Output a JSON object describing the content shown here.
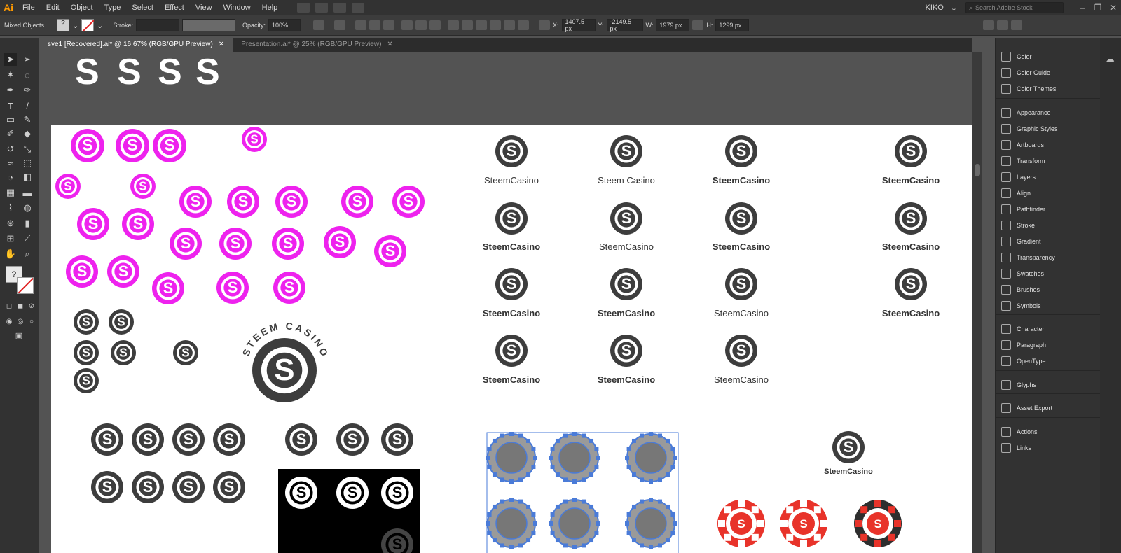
{
  "app": {
    "logo": "Ai"
  },
  "menu": [
    "File",
    "Edit",
    "Object",
    "Type",
    "Select",
    "Effect",
    "View",
    "Window",
    "Help"
  ],
  "workspace": "KIKO",
  "search": {
    "placeholder": "Search Adobe Stock"
  },
  "window_controls": [
    "–",
    "❐",
    "✕"
  ],
  "controlbar": {
    "selection": "Mixed Objects",
    "stroke_label": "Stroke:",
    "opacity_label": "Opacity:",
    "opacity_value": "100%",
    "x_label": "X:",
    "x_value": "1407.5 px",
    "y_label": "Y:",
    "y_value": "-2149.5 px",
    "w_label": "W:",
    "w_value": "1979 px",
    "h_label": "H:",
    "h_value": "1299 px"
  },
  "tabs": [
    {
      "label": "sve1 [Recovered].ai* @ 16.67% (RGB/GPU Preview)",
      "close": "✕"
    },
    {
      "label": "Presentation.ai* @ 25% (RGB/GPU Preview)",
      "close": "✕"
    }
  ],
  "logo_variants": {
    "row1": [
      "SteemCasino",
      "Steem Casino",
      "SteemCasino",
      "SteemCasino"
    ],
    "row2": [
      "SteemCasino",
      "SteemCasino",
      "SteemCasino",
      "SteemCasino"
    ],
    "row3": [
      "SteemCasino",
      "SteemCasino",
      "SteemCasino",
      "SteemCasino"
    ],
    "row4": [
      "SteemCasino",
      "SteemCasino",
      "SteemCasino"
    ],
    "single": "SteemCasino",
    "arc_text": "STEEM CASINO"
  },
  "panels": [
    {
      "label": "Color",
      "icon": "color-icon"
    },
    {
      "label": "Color Guide",
      "icon": "color-guide-icon"
    },
    {
      "label": "Color Themes",
      "icon": "color-themes-icon"
    },
    {
      "label": "Appearance",
      "icon": "appearance-icon"
    },
    {
      "label": "Graphic Styles",
      "icon": "graphic-styles-icon"
    },
    {
      "label": "Artboards",
      "icon": "artboards-icon"
    },
    {
      "label": "Transform",
      "icon": "transform-icon"
    },
    {
      "label": "Layers",
      "icon": "layers-icon"
    },
    {
      "label": "Align",
      "icon": "align-icon"
    },
    {
      "label": "Pathfinder",
      "icon": "pathfinder-icon"
    },
    {
      "label": "Stroke",
      "icon": "stroke-icon"
    },
    {
      "label": "Gradient",
      "icon": "gradient-icon"
    },
    {
      "label": "Transparency",
      "icon": "transparency-icon"
    },
    {
      "label": "Swatches",
      "icon": "swatches-icon"
    },
    {
      "label": "Brushes",
      "icon": "brushes-icon"
    },
    {
      "label": "Symbols",
      "icon": "symbols-icon"
    },
    {
      "label": "Character",
      "icon": "character-icon"
    },
    {
      "label": "Paragraph",
      "icon": "paragraph-icon"
    },
    {
      "label": "OpenType",
      "icon": "opentype-icon"
    },
    {
      "label": "Glyphs",
      "icon": "glyphs-icon"
    },
    {
      "label": "Asset Export",
      "icon": "asset-export-icon"
    },
    {
      "label": "Actions",
      "icon": "actions-icon"
    },
    {
      "label": "Links",
      "icon": "links-icon"
    }
  ],
  "colors": {
    "magenta": "#ee22ee",
    "dark": "#3d3d3d",
    "red": "#e8332a",
    "selection": "#4a7bd8"
  }
}
